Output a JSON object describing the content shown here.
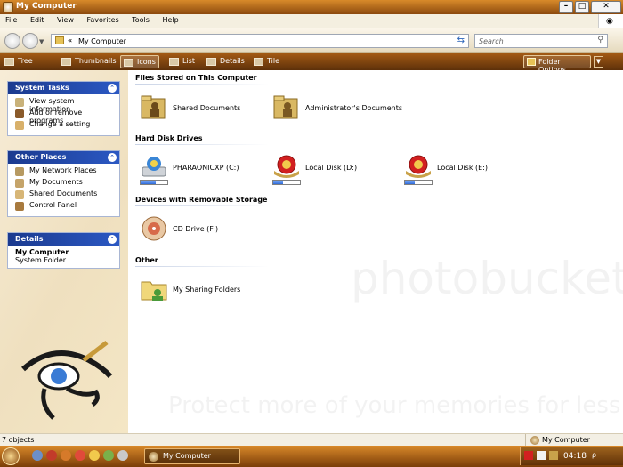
{
  "window": {
    "title": "My Computer"
  },
  "menu": {
    "items": [
      "File",
      "Edit",
      "View",
      "Favorites",
      "Tools",
      "Help"
    ]
  },
  "address": {
    "path": "My Computer",
    "chevron": "«"
  },
  "search": {
    "placeholder": "Search"
  },
  "toolbar": {
    "buttons": [
      "Tree",
      "Thumbnails",
      "Icons",
      "List",
      "Details",
      "Tile"
    ],
    "active": "Icons",
    "folder_options": "Folder Options"
  },
  "sidebar": {
    "system_tasks": {
      "title": "System Tasks",
      "items": [
        "View system information",
        "Add or remove programs",
        "Change a setting"
      ]
    },
    "other_places": {
      "title": "Other Places",
      "items": [
        "My Network Places",
        "My Documents",
        "Shared Documents",
        "Control Panel"
      ]
    },
    "details": {
      "title": "Details",
      "name": "My Computer",
      "type": "System Folder"
    }
  },
  "content": {
    "groups": [
      {
        "title": "Files Stored on This Computer",
        "items": [
          {
            "label": "Shared Documents"
          },
          {
            "label": "Administrator's Documents"
          }
        ]
      },
      {
        "title": "Hard Disk Drives",
        "items": [
          {
            "label": "PHARAONICXP (C:)",
            "usage": 0.55
          },
          {
            "label": "Local Disk (D:)",
            "usage": 0.35
          },
          {
            "label": "Local Disk (E:)",
            "usage": 0.35
          }
        ]
      },
      {
        "title": "Devices with Removable Storage",
        "items": [
          {
            "label": "CD Drive (F:)"
          }
        ]
      },
      {
        "title": "Other",
        "items": [
          {
            "label": "My Sharing Folders"
          }
        ]
      }
    ]
  },
  "watermark": {
    "main": "photobucket",
    "sub": "Protect more of your memories for less!"
  },
  "status": {
    "count": "7 objects",
    "location": "My Computer"
  },
  "taskbar": {
    "task": "My Computer",
    "clock": "04:18"
  },
  "colors": {
    "accent": "#8c4a0e",
    "panel_header": "#1b3a8f",
    "drive_bar": "#2f6ad6"
  }
}
